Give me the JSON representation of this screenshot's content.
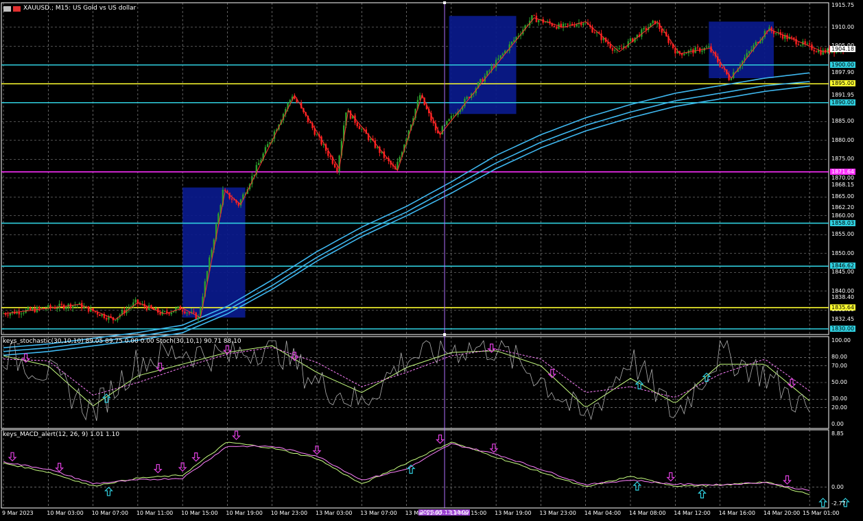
{
  "header": {
    "symbol_title": "XAUUSD.; M15: US Gold vs US dollar",
    "stoch_title": "keys_stochastic(30,10,10) 89.05 89.75 0.00 0.00 Stoch(30,10,1) 90.71 88.10",
    "macd_title": "keys_MACD_alert(12, 26, 9) 1.01 1.10"
  },
  "colors": {
    "background": "#000000",
    "grid": "#c8c8c8",
    "bull_candle": "#2ca02c",
    "bear_candle": "#ff1e1e",
    "zigzag": "#ff3030",
    "ma": "#3fb8f0",
    "hline_cyan": "#30d0e0",
    "hline_yellow": "#ffff30",
    "hline_magenta": "#ff30ff",
    "zone": "#0a1a8c",
    "stoch_main": "#c8ff80",
    "stoch_signal": "#ff80ff",
    "stoch_raw": "#b0b0b0",
    "arrow_up": "#30d0e0",
    "arrow_down": "#e040e0"
  },
  "price_axis": {
    "ticks": [
      "1915.75",
      "1910.00",
      "1905.00",
      "1900.00",
      "1897.90",
      "1895.00",
      "1891.95",
      "1890.00",
      "1885.00",
      "1880.00",
      "1875.00",
      "1870.00",
      "1868.15",
      "1865.00",
      "1862.20",
      "1860.00",
      "1855.00",
      "1850.00",
      "1845.00",
      "1840.00",
      "1838.40",
      "1835.00",
      "1832.45",
      "1830.00"
    ],
    "badges": [
      {
        "text": "1900.00",
        "bg": "#30d0e0",
        "fg": "#000000",
        "price": 1900.0
      },
      {
        "text": "1895.00",
        "bg": "#ffff30",
        "fg": "#000000",
        "price": 1895.0
      },
      {
        "text": "1890.00",
        "bg": "#30d0e0",
        "fg": "#000000",
        "price": 1890.0
      },
      {
        "text": "1871.64",
        "bg": "#ff30ff",
        "fg": "#ffffff",
        "price": 1871.64
      },
      {
        "text": "1858.03",
        "bg": "#30d0e0",
        "fg": "#000000",
        "price": 1858.03
      },
      {
        "text": "1846.62",
        "bg": "#30d0e0",
        "fg": "#000000",
        "price": 1846.62
      },
      {
        "text": "1835.64",
        "bg": "#ffff30",
        "fg": "#000000",
        "price": 1835.64
      },
      {
        "text": "1830.00",
        "bg": "#30d0e0",
        "fg": "#000000",
        "price": 1830.0
      },
      {
        "text": "1904.18",
        "bg": "#ffffff",
        "fg": "#000000",
        "price": 1904.18
      }
    ]
  },
  "stoch_axis": {
    "ticks": [
      "100.00",
      "80.00",
      "70.00",
      "50.00",
      "30.00",
      "20.00",
      "0.00"
    ]
  },
  "macd_axis": {
    "ticks": [
      "8.85",
      "0.00",
      "-2.77"
    ]
  },
  "time_axis": {
    "labels": [
      "9 Mar 2023",
      "10 Mar 03:00",
      "10 Mar 07:00",
      "10 Mar 11:00",
      "10 Mar 15:00",
      "10 Mar 19:00",
      "10 Mar 23:00",
      "13 Mar 03:00",
      "13 Mar 07:00",
      "13 Mar 11:00",
      "13 Mar 15:00",
      "13 Mar 19:00",
      "13 Mar 23:00",
      "14 Mar 04:00",
      "14 Mar 08:00",
      "14 Mar 12:00",
      "14 Mar 16:00",
      "14 Mar 20:00",
      "15 Mar 01:00"
    ],
    "cursor_label": "2023.03.13 14:00"
  },
  "chart_data": [
    {
      "type": "line",
      "name": "price",
      "title": "XAUUSD.; M15: US Gold vs US dollar",
      "candles_description": "M15 candles",
      "x": [
        "9 Mar 2023",
        "10 Mar 03:00",
        "10 Mar 07:00",
        "10 Mar 11:00",
        "10 Mar 15:00",
        "10 Mar 19:00",
        "10 Mar 23:00",
        "13 Mar 03:00",
        "13 Mar 07:00",
        "13 Mar 11:00",
        "13 Mar 15:00",
        "13 Mar 19:00",
        "13 Mar 23:00",
        "14 Mar 04:00",
        "14 Mar 08:00",
        "14 Mar 12:00",
        "14 Mar 16:00",
        "14 Mar 20:00",
        "15 Mar 01:00"
      ],
      "close_path": [
        1834.0,
        1834.5,
        1833.5,
        1836.5,
        1834.5,
        1864.0,
        1866.0,
        1891.0,
        1877.0,
        1889.5,
        1910.5,
        1913.5,
        1911.0,
        1904.5,
        1911.5,
        1903.0,
        1908.5,
        1903.5,
        1904.18
      ],
      "zigzag": [
        {
          "x": 0.0,
          "p": 1834.0
        },
        {
          "x": 1.7,
          "p": 1836.5
        },
        {
          "x": 2.5,
          "p": 1832.5
        },
        {
          "x": 3.0,
          "p": 1837.0
        },
        {
          "x": 3.6,
          "p": 1834.0
        },
        {
          "x": 4.0,
          "p": 1835.5
        },
        {
          "x": 4.4,
          "p": 1833.0
        },
        {
          "x": 4.95,
          "p": 1866.5
        },
        {
          "x": 5.3,
          "p": 1863.0
        },
        {
          "x": 6.5,
          "p": 1892.0
        },
        {
          "x": 7.5,
          "p": 1872.5
        },
        {
          "x": 7.7,
          "p": 1888.0
        },
        {
          "x": 8.8,
          "p": 1872.0
        },
        {
          "x": 9.35,
          "p": 1892.0
        },
        {
          "x": 9.75,
          "p": 1881.5
        },
        {
          "x": 11.85,
          "p": 1912.5
        },
        {
          "x": 12.5,
          "p": 1910.0
        },
        {
          "x": 13.0,
          "p": 1911.5
        },
        {
          "x": 13.75,
          "p": 1903.5
        },
        {
          "x": 14.6,
          "p": 1911.5
        },
        {
          "x": 15.1,
          "p": 1903.0
        },
        {
          "x": 15.8,
          "p": 1904.5
        },
        {
          "x": 16.25,
          "p": 1896.5
        },
        {
          "x": 17.1,
          "p": 1909.5
        },
        {
          "x": 18.3,
          "p": 1903.5
        },
        {
          "x": 18.8,
          "p": 1904.18
        }
      ],
      "moving_averages": [
        {
          "values": [
            1825.0,
            1826.0,
            1827.5,
            1829.0,
            1831.0,
            1836.0,
            1843.0,
            1850.5,
            1857.0,
            1862.5,
            1869.0,
            1876.0,
            1881.5,
            1886.0,
            1889.5,
            1892.5,
            1894.5,
            1896.5,
            1897.9
          ]
        },
        {
          "values": [
            1824.0,
            1825.0,
            1826.5,
            1828.0,
            1830.0,
            1835.0,
            1841.5,
            1849.0,
            1855.5,
            1861.0,
            1867.5,
            1874.0,
            1879.5,
            1884.0,
            1887.5,
            1890.5,
            1892.5,
            1894.5,
            1895.6
          ]
        },
        {
          "values": [
            1823.0,
            1824.0,
            1825.5,
            1827.0,
            1829.0,
            1834.0,
            1840.5,
            1848.0,
            1854.5,
            1860.0,
            1866.0,
            1872.5,
            1878.0,
            1882.5,
            1886.0,
            1889.0,
            1891.0,
            1893.0,
            1894.4
          ]
        }
      ],
      "horizontal_levels": [
        1900.0,
        1895.0,
        1890.0,
        1871.64,
        1858.03,
        1846.62,
        1835.64,
        1830.0
      ],
      "zones": [
        {
          "x_from": 4.0,
          "x_to": 5.4,
          "p_from": 1833.0,
          "p_to": 1867.5
        },
        {
          "x_from": 9.95,
          "x_to": 11.45,
          "p_from": 1887.0,
          "p_to": 1913.0
        },
        {
          "x_from": 15.75,
          "x_to": 17.2,
          "p_from": 1896.5,
          "p_to": 1911.5
        }
      ],
      "ylim": [
        1828.5,
        1916.5
      ]
    },
    {
      "type": "line",
      "name": "keys_stochastic",
      "title": "keys_stochastic(30,10,10) 89.05 89.75 0.00 0.00 Stoch(30,10,1) 90.71 88.10",
      "x": [
        "9 Mar 2023",
        "10 Mar 03:00",
        "10 Mar 07:00",
        "10 Mar 11:00",
        "10 Mar 15:00",
        "10 Mar 19:00",
        "10 Mar 23:00",
        "13 Mar 03:00",
        "13 Mar 07:00",
        "13 Mar 11:00",
        "13 Mar 15:00",
        "13 Mar 19:00",
        "13 Mar 23:00",
        "14 Mar 04:00",
        "14 Mar 08:00",
        "14 Mar 12:00",
        "14 Mar 16:00",
        "14 Mar 20:00",
        "15 Mar 01:00"
      ],
      "series": [
        {
          "values": [
            82.0,
            70.0,
            22.0,
            58.0,
            72.0,
            86.0,
            94.0,
            62.0,
            38.0,
            68.0,
            86.0,
            88.0,
            70.0,
            20.0,
            55.0,
            25.0,
            72.0,
            72.0,
            28.0
          ]
        },
        {
          "values": [
            78.0,
            76.0,
            35.0,
            50.0,
            68.0,
            84.0,
            92.0,
            74.0,
            45.0,
            62.0,
            82.0,
            90.0,
            78.0,
            38.0,
            45.0,
            32.0,
            60.0,
            78.0,
            40.0
          ]
        },
        {
          "values": [
            85.0,
            62.0,
            15.0,
            75.0,
            88.0,
            80.0,
            96.0,
            50.0,
            25.0,
            80.0,
            90.0,
            92.0,
            55.0,
            5.0,
            80.0,
            10.0,
            85.0,
            60.0,
            15.0
          ]
        }
      ],
      "arrows_up": [
        2.3,
        14.2,
        15.7
      ],
      "arrows_down": [
        0.5,
        3.5,
        5.0,
        6.5,
        10.9,
        12.25,
        17.6
      ],
      "ylim": [
        0,
        100
      ]
    },
    {
      "type": "line",
      "name": "keys_MACD_alert",
      "title": "keys_MACD_alert(12, 26, 9) 1.01 1.10",
      "x": [
        "9 Mar 2023",
        "10 Mar 03:00",
        "10 Mar 07:00",
        "10 Mar 11:00",
        "10 Mar 15:00",
        "10 Mar 19:00",
        "10 Mar 23:00",
        "13 Mar 03:00",
        "13 Mar 07:00",
        "13 Mar 11:00",
        "13 Mar 15:00",
        "13 Mar 19:00",
        "13 Mar 23:00",
        "14 Mar 04:00",
        "14 Mar 08:00",
        "14 Mar 12:00",
        "14 Mar 16:00",
        "14 Mar 20:00",
        "15 Mar 01:00"
      ],
      "series": [
        {
          "values": [
            4.0,
            2.5,
            0.2,
            1.5,
            2.0,
            7.5,
            6.5,
            4.8,
            0.5,
            4.0,
            7.5,
            5.0,
            2.5,
            0.0,
            1.8,
            0.2,
            0.3,
            0.9,
            -1.2
          ]
        },
        {
          "values": [
            4.2,
            3.0,
            0.6,
            1.2,
            1.5,
            6.8,
            6.8,
            5.2,
            1.2,
            3.0,
            7.2,
            5.5,
            3.0,
            0.4,
            1.2,
            0.5,
            0.4,
            0.8,
            -0.6
          ]
        }
      ],
      "arrows_up": [
        2.35,
        9.1,
        14.15,
        15.6,
        18.3,
        18.8
      ],
      "arrows_down": [
        0.2,
        1.25,
        3.45,
        4.0,
        4.3,
        5.2,
        7.0,
        9.75,
        10.95,
        14.9,
        17.5
      ],
      "ylim": [
        -2.77,
        8.85
      ]
    }
  ]
}
